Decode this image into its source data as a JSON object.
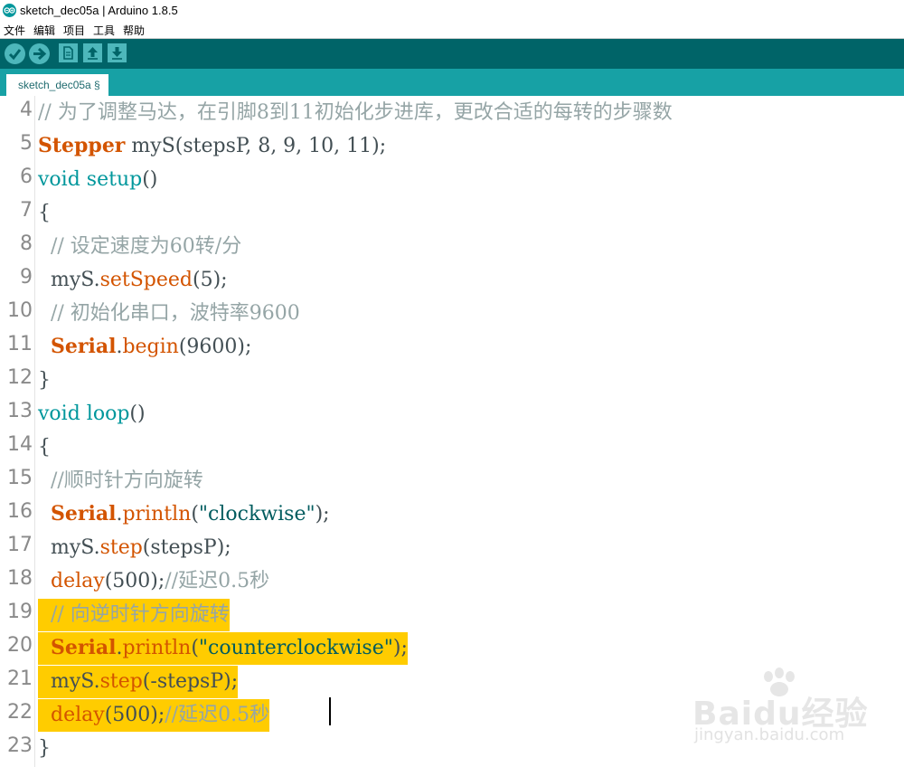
{
  "window": {
    "title": "sketch_dec05a | Arduino 1.8.5"
  },
  "menu": {
    "items": [
      "文件",
      "编辑",
      "项目",
      "工具",
      "帮助"
    ]
  },
  "toolbar": {
    "buttons": [
      "verify-icon",
      "upload-icon",
      "new-icon",
      "open-icon",
      "save-icon"
    ]
  },
  "tabs": [
    {
      "label": "sketch_dec05a §"
    }
  ],
  "editor": {
    "lines": [
      {
        "num": "4",
        "parts": [
          {
            "t": "// 为了调整马达，在引脚8到11初始化步进库，更改合适的每转的步骤数",
            "c": "cmt"
          }
        ]
      },
      {
        "num": "5",
        "parts": [
          {
            "t": "Stepper",
            "c": "ty"
          },
          {
            "t": " myS(stepsP, 8, 9, 10, 11);",
            "c": "tx"
          }
        ]
      },
      {
        "num": "6",
        "parts": [
          {
            "t": "void",
            "c": "kw"
          },
          {
            "t": " ",
            "c": "tx"
          },
          {
            "t": "setup",
            "c": "kw"
          },
          {
            "t": "()",
            "c": "tx"
          }
        ]
      },
      {
        "num": "7",
        "parts": [
          {
            "t": "{",
            "c": "tx"
          }
        ]
      },
      {
        "num": "8",
        "parts": [
          {
            "t": "  // 设定速度为60转/分",
            "c": "cmt"
          }
        ]
      },
      {
        "num": "9",
        "parts": [
          {
            "t": "  myS.",
            "c": "tx"
          },
          {
            "t": "setSpeed",
            "c": "fn"
          },
          {
            "t": "(5);",
            "c": "tx"
          }
        ]
      },
      {
        "num": "10",
        "parts": [
          {
            "t": "  // 初始化串口，波特率9600",
            "c": "cmt"
          }
        ]
      },
      {
        "num": "11",
        "parts": [
          {
            "t": "  ",
            "c": "tx"
          },
          {
            "t": "Serial",
            "c": "ty"
          },
          {
            "t": ".",
            "c": "tx"
          },
          {
            "t": "begin",
            "c": "fn"
          },
          {
            "t": "(9600);",
            "c": "tx"
          }
        ]
      },
      {
        "num": "12",
        "parts": [
          {
            "t": "}",
            "c": "tx"
          }
        ]
      },
      {
        "num": "13",
        "parts": [
          {
            "t": "void",
            "c": "kw"
          },
          {
            "t": " ",
            "c": "tx"
          },
          {
            "t": "loop",
            "c": "kw"
          },
          {
            "t": "()",
            "c": "tx"
          }
        ]
      },
      {
        "num": "14",
        "parts": [
          {
            "t": "{",
            "c": "tx"
          }
        ]
      },
      {
        "num": "15",
        "parts": [
          {
            "t": "  //顺时针方向旋转",
            "c": "cmt"
          }
        ]
      },
      {
        "num": "16",
        "parts": [
          {
            "t": "  ",
            "c": "tx"
          },
          {
            "t": "Serial",
            "c": "ty"
          },
          {
            "t": ".",
            "c": "tx"
          },
          {
            "t": "println",
            "c": "fn"
          },
          {
            "t": "(",
            "c": "tx"
          },
          {
            "t": "\"clockwise\"",
            "c": "str"
          },
          {
            "t": ");",
            "c": "tx"
          }
        ]
      },
      {
        "num": "17",
        "parts": [
          {
            "t": "  myS.",
            "c": "tx"
          },
          {
            "t": "step",
            "c": "fn"
          },
          {
            "t": "(stepsP);",
            "c": "tx"
          }
        ]
      },
      {
        "num": "18",
        "parts": [
          {
            "t": "  ",
            "c": "tx"
          },
          {
            "t": "delay",
            "c": "fn"
          },
          {
            "t": "(500);",
            "c": "tx"
          },
          {
            "t": "//延迟0.5秒",
            "c": "cmt"
          }
        ]
      },
      {
        "num": "19",
        "parts": [
          {
            "t": "  // 向逆时针方向旋转",
            "c": "cmt"
          }
        ]
      },
      {
        "num": "20",
        "parts": [
          {
            "t": "  ",
            "c": "tx"
          },
          {
            "t": "Serial",
            "c": "ty"
          },
          {
            "t": ".",
            "c": "tx"
          },
          {
            "t": "println",
            "c": "fn"
          },
          {
            "t": "(",
            "c": "tx"
          },
          {
            "t": "\"counterclockwise\"",
            "c": "str"
          },
          {
            "t": ");",
            "c": "tx"
          }
        ]
      },
      {
        "num": "21",
        "parts": [
          {
            "t": "  myS.",
            "c": "tx"
          },
          {
            "t": "step",
            "c": "fn"
          },
          {
            "t": "(-stepsP);",
            "c": "tx"
          }
        ]
      },
      {
        "num": "22",
        "parts": [
          {
            "t": "  ",
            "c": "tx"
          },
          {
            "t": "delay",
            "c": "fn"
          },
          {
            "t": "(500);",
            "c": "tx"
          },
          {
            "t": "//延迟0.5秒",
            "c": "cmt"
          }
        ]
      },
      {
        "num": "23",
        "parts": [
          {
            "t": "}",
            "c": "tx"
          }
        ]
      }
    ],
    "selection": {
      "lines": [
        "19",
        "20",
        "21",
        "22"
      ],
      "color": "#ffcc00"
    }
  },
  "watermark": {
    "brand": "Baidu经验",
    "url": "jingyan.baidu.com"
  },
  "colors": {
    "toolbar": "#006468",
    "tabbar": "#17a1a5",
    "comment": "#95a5a6",
    "keyword": "#00979c",
    "type": "#d35400",
    "string": "#005c5f",
    "text": "#434f54"
  }
}
